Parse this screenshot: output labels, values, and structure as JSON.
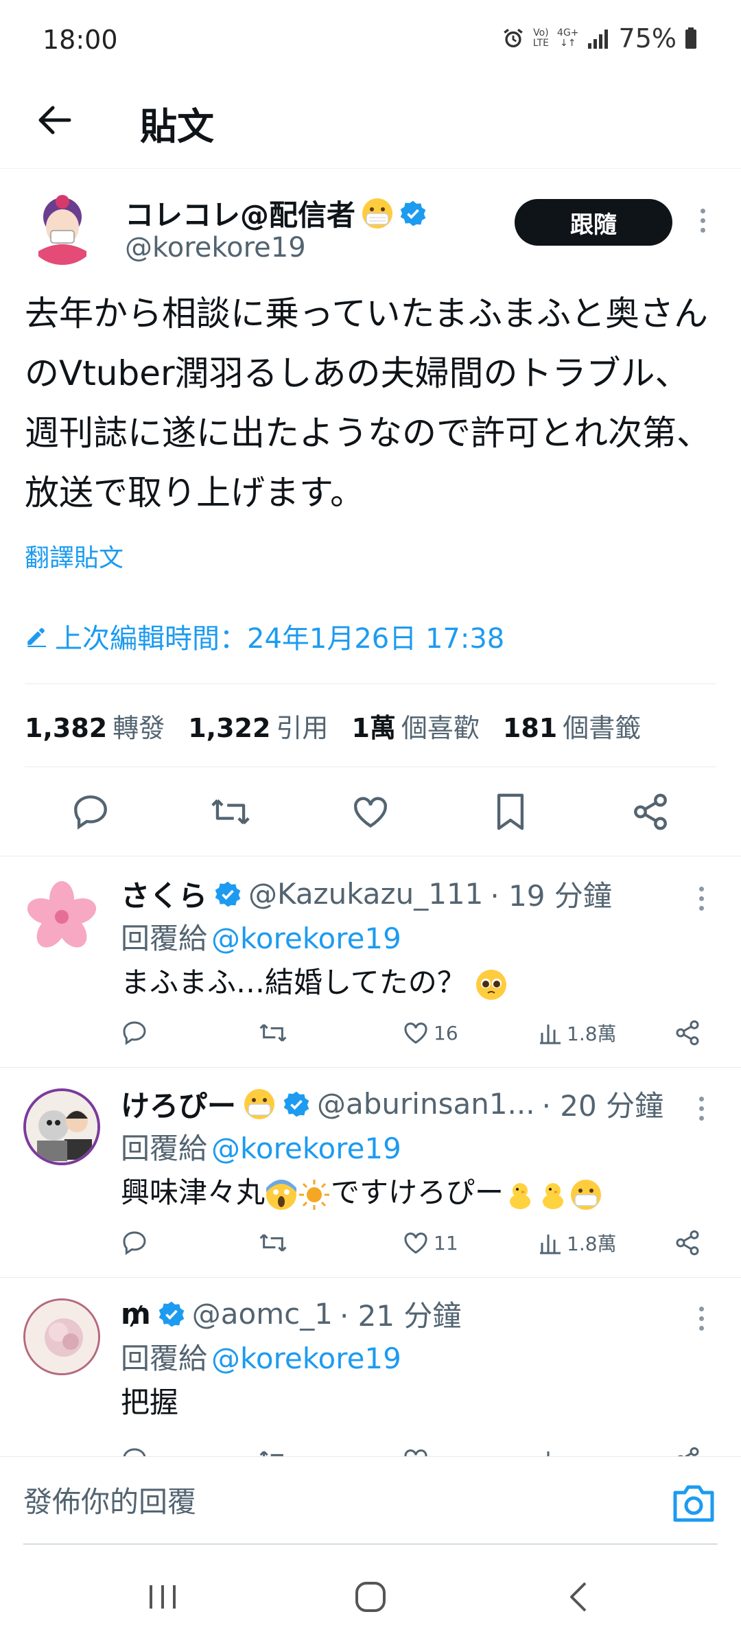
{
  "status_bar": {
    "time": "18:00",
    "network_top": "Vo)",
    "network_bottom": "LTE",
    "gen_label": "4G+",
    "battery": "75%"
  },
  "header": {
    "title": "貼文"
  },
  "tweet": {
    "author_name": "コレコレ@配信者",
    "author_handle": "@korekore19",
    "follow_label": "跟隨",
    "text": "去年から相談に乗っていたまふまふと奥さんのVtuber潤羽るしあの夫婦間のトラブル、週刊誌に遂に出たようなので許可とれ次第、放送で取り上げます。",
    "translate_label": "翻譯貼文",
    "edited_label": "上次編輯時間：24年1月26日 17:38",
    "stats": [
      {
        "num": "1,382",
        "label": "轉發"
      },
      {
        "num": "1,322",
        "label": "引用"
      },
      {
        "num": "1萬",
        "label": "個喜歡"
      },
      {
        "num": "181",
        "label": "個書籤"
      }
    ]
  },
  "replies": [
    {
      "name": "さくら",
      "handle": "@Kazukazu_111",
      "time": "· 19 分鐘",
      "reply_to_label": "回覆給",
      "reply_to_handle": "@korekore19",
      "body": "まふまふ…結婚してたの？",
      "likes": "16",
      "views": "1.8萬"
    },
    {
      "name": "けろぴー",
      "handle": "@aburinsan1...",
      "time": "· 20 分鐘",
      "reply_to_label": "回覆給",
      "reply_to_handle": "@korekore19",
      "body": "興味津々丸",
      "body_suffix": "ですけろぴー",
      "likes": "11",
      "views": "1.8萬"
    },
    {
      "name": "₥",
      "handle": "@aomc_1",
      "time": "· 21 分鐘",
      "reply_to_label": "回覆給",
      "reply_to_handle": "@korekore19",
      "body": "把握"
    }
  ],
  "reply_bar": {
    "placeholder": "發佈你的回覆"
  },
  "colors": {
    "accent": "#1d9bf0",
    "text": "#0f1419",
    "muted": "#536471"
  }
}
